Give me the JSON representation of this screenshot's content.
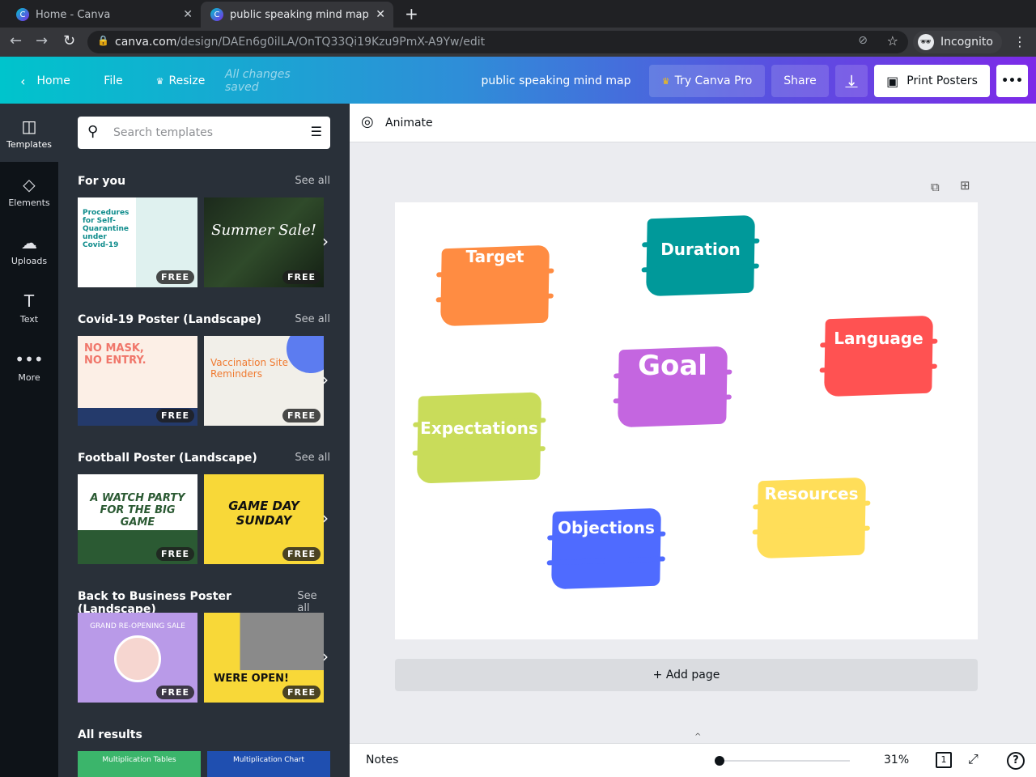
{
  "browser": {
    "tabs": [
      {
        "title": "Home - Canva"
      },
      {
        "title": "public speaking mind map"
      }
    ],
    "url_domain": "canva.com",
    "url_path": "/design/DAEn6g0ilLA/OnTQ33Qi19Kzu9PmX-A9Yw/edit",
    "profile": "Incognito"
  },
  "header": {
    "home": "Home",
    "file": "File",
    "resize": "Resize",
    "status": "All changes saved",
    "doc_title": "public speaking mind map",
    "try_pro": "Try Canva Pro",
    "share": "Share",
    "print": "Print Posters"
  },
  "rail": [
    {
      "label": "Templates"
    },
    {
      "label": "Elements"
    },
    {
      "label": "Uploads"
    },
    {
      "label": "Text"
    },
    {
      "label": "More"
    }
  ],
  "panel": {
    "search_placeholder": "Search templates",
    "see_all": "See all",
    "free": "FREE",
    "sections": [
      {
        "title": "For you",
        "thumbs": [
          "Procedures for Self-Quarantine under Covid-19",
          "Summer Sale!"
        ]
      },
      {
        "title": "Covid-19 Poster (Landscape)",
        "thumbs": [
          "NO MASK, NO ENTRY.",
          "Vaccination Site Reminders"
        ]
      },
      {
        "title": "Football Poster (Landscape)",
        "thumbs": [
          "A WATCH PARTY FOR THE BIG GAME",
          "GAME DAY SUNDAY"
        ]
      },
      {
        "title": "Back to Business Poster (Landscape)",
        "thumbs": [
          "GRAND RE-OPENING SALE",
          "WERE OPEN!"
        ]
      }
    ],
    "all_results": "All results",
    "results": [
      "Multiplication Tables",
      "Multiplication Chart"
    ]
  },
  "editor": {
    "animate": "Animate",
    "add_page": "+ Add page",
    "notes": "Notes",
    "zoom": "31%",
    "page_num": "1",
    "zoom_fraction": 0.0
  },
  "mindmap": [
    {
      "label": "Target",
      "color": "#ff8c42"
    },
    {
      "label": "Duration",
      "color": "#00999a"
    },
    {
      "label": "Language",
      "color": "#ff5252"
    },
    {
      "label": "Goal",
      "color": "#c466e0"
    },
    {
      "label": "Expectations",
      "color": "#c9dc5a"
    },
    {
      "label": "Resources",
      "color": "#ffde59"
    },
    {
      "label": "Objections",
      "color": "#4f6bff"
    }
  ]
}
